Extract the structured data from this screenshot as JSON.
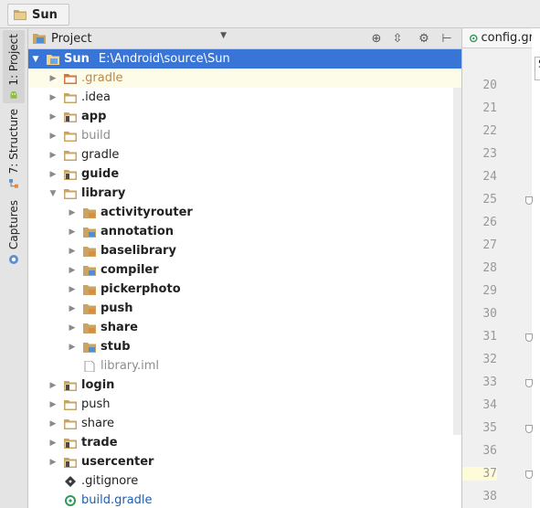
{
  "breadcrumb": {
    "label": "Sun",
    "icon": "folder-icon"
  },
  "side_tabs": [
    {
      "label": "1: Project",
      "icon": "android-icon",
      "active": true
    },
    {
      "label": "7: Structure",
      "icon": "structure-icon",
      "active": false
    },
    {
      "label": "Captures",
      "icon": "camera-icon",
      "active": false
    }
  ],
  "project_header": {
    "view_label": "Project",
    "buttons": [
      "target-icon",
      "collapse-icon",
      "gear-icon",
      "hide-icon"
    ]
  },
  "tree": {
    "root": {
      "name": "Sun",
      "path": "E:\\Android\\source\\Sun"
    },
    "items": [
      {
        "name": ".gradle",
        "depth": 1,
        "type": "folder-orange",
        "expandable": true,
        "style": "orange"
      },
      {
        "name": ".idea",
        "depth": 1,
        "type": "folder",
        "expandable": true,
        "style": "normal"
      },
      {
        "name": "app",
        "depth": 1,
        "type": "module",
        "expandable": true,
        "style": "bold"
      },
      {
        "name": "build",
        "depth": 1,
        "type": "folder",
        "expandable": true,
        "style": "muted"
      },
      {
        "name": "gradle",
        "depth": 1,
        "type": "folder",
        "expandable": true,
        "style": "normal"
      },
      {
        "name": "guide",
        "depth": 1,
        "type": "module",
        "expandable": true,
        "style": "bold"
      },
      {
        "name": "library",
        "depth": 1,
        "type": "folder",
        "expandable": true,
        "expanded": true,
        "style": "bold"
      },
      {
        "name": "activityrouter",
        "depth": 2,
        "type": "module-orange",
        "expandable": true,
        "style": "bold"
      },
      {
        "name": "annotation",
        "depth": 2,
        "type": "module-blue",
        "expandable": true,
        "style": "bold"
      },
      {
        "name": "baselibrary",
        "depth": 2,
        "type": "module-orange",
        "expandable": true,
        "style": "bold"
      },
      {
        "name": "compiler",
        "depth": 2,
        "type": "module-blue",
        "expandable": true,
        "style": "bold"
      },
      {
        "name": "pickerphoto",
        "depth": 2,
        "type": "module-orange",
        "expandable": true,
        "style": "bold"
      },
      {
        "name": "push",
        "depth": 2,
        "type": "module-orange",
        "expandable": true,
        "style": "bold"
      },
      {
        "name": "share",
        "depth": 2,
        "type": "module-orange",
        "expandable": true,
        "style": "bold"
      },
      {
        "name": "stub",
        "depth": 2,
        "type": "module-blue",
        "expandable": true,
        "style": "bold"
      },
      {
        "name": "library.iml",
        "depth": 2,
        "type": "file",
        "expandable": false,
        "style": "muted"
      },
      {
        "name": "login",
        "depth": 1,
        "type": "module",
        "expandable": true,
        "style": "bold"
      },
      {
        "name": "push",
        "depth": 1,
        "type": "folder",
        "expandable": true,
        "style": "normal"
      },
      {
        "name": "share",
        "depth": 1,
        "type": "folder",
        "expandable": true,
        "style": "normal"
      },
      {
        "name": "trade",
        "depth": 1,
        "type": "module",
        "expandable": true,
        "style": "bold"
      },
      {
        "name": "usercenter",
        "depth": 1,
        "type": "module",
        "expandable": true,
        "style": "bold"
      },
      {
        "name": ".gitignore",
        "depth": 1,
        "type": "git-file",
        "expandable": false,
        "style": "normal"
      },
      {
        "name": "build.gradle",
        "depth": 1,
        "type": "gradle-file",
        "expandable": false,
        "style": "blue"
      }
    ]
  },
  "editor": {
    "tab_label": "config.gra",
    "search_text": "S",
    "line_numbers": [
      "20",
      "21",
      "22",
      "23",
      "24",
      "25",
      "26",
      "27",
      "28",
      "29",
      "30",
      "31",
      "32",
      "33",
      "34",
      "35",
      "36",
      "37",
      "38"
    ],
    "current_line": "37",
    "fold_lines": [
      "25",
      "31",
      "33",
      "35",
      "37"
    ]
  },
  "colors": {
    "selection": "#3875d7",
    "folder": "#c9a463",
    "module_badge_orange": "#e08a3a",
    "module_badge_blue": "#4d8fd6",
    "gradle": "#2e9a5a"
  }
}
